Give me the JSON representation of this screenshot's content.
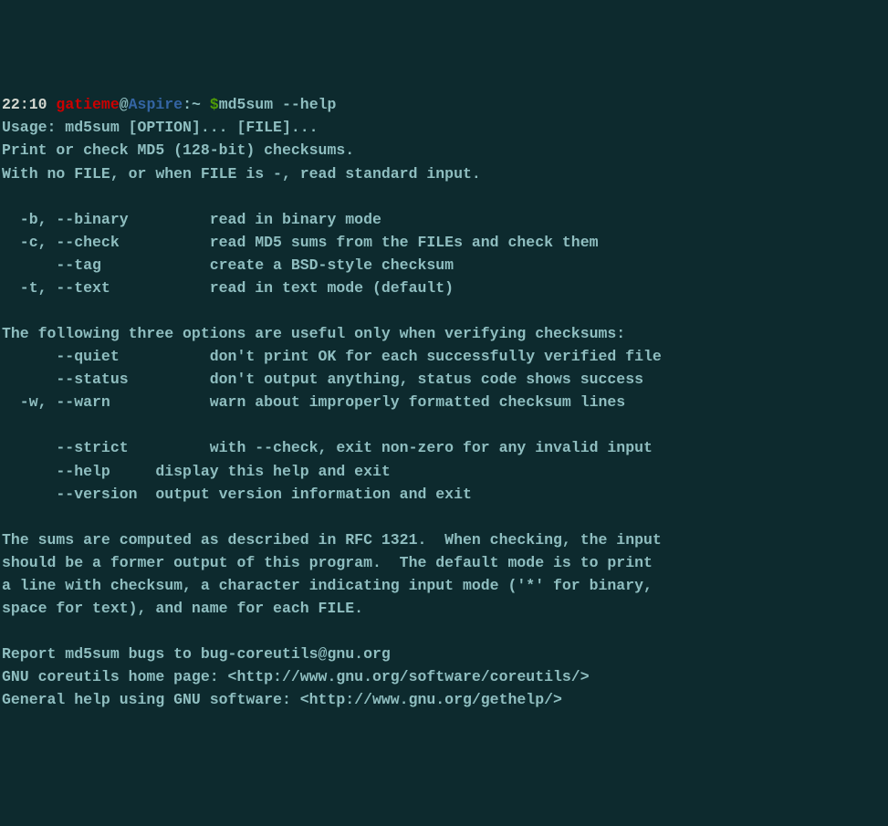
{
  "prompt": {
    "time": "22:10",
    "user": "gatieme",
    "at": "@",
    "host": "Aspire",
    "colon": ":",
    "path": "~",
    "dollar": " $",
    "command": "md5sum --help"
  },
  "output": {
    "l1": "Usage: md5sum [OPTION]... [FILE]...",
    "l2": "Print or check MD5 (128-bit) checksums.",
    "l3": "With no FILE, or when FILE is -, read standard input.",
    "l4": "",
    "l5": "  -b, --binary         read in binary mode",
    "l6": "  -c, --check          read MD5 sums from the FILEs and check them",
    "l7": "      --tag            create a BSD-style checksum",
    "l8": "  -t, --text           read in text mode (default)",
    "l9": "",
    "l10": "The following three options are useful only when verifying checksums:",
    "l11": "      --quiet          don't print OK for each successfully verified file",
    "l12": "      --status         don't output anything, status code shows success",
    "l13": "  -w, --warn           warn about improperly formatted checksum lines",
    "l14": "",
    "l15": "      --strict         with --check, exit non-zero for any invalid input",
    "l16": "      --help     display this help and exit",
    "l17": "      --version  output version information and exit",
    "l18": "",
    "l19": "The sums are computed as described in RFC 1321.  When checking, the input",
    "l20": "should be a former output of this program.  The default mode is to print",
    "l21": "a line with checksum, a character indicating input mode ('*' for binary,",
    "l22": "space for text), and name for each FILE.",
    "l23": "",
    "l24": "Report md5sum bugs to bug-coreutils@gnu.org",
    "l25": "GNU coreutils home page: <http://www.gnu.org/software/coreutils/>",
    "l26": "General help using GNU software: <http://www.gnu.org/gethelp/>"
  }
}
